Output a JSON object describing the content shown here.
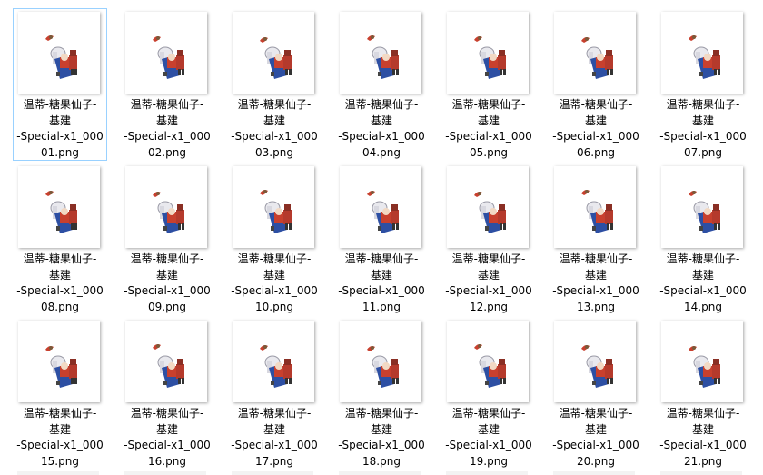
{
  "files": [
    {
      "name_lines": [
        "温蒂-糖果仙子-",
        "基建",
        "-Special-x1_000",
        "01.png"
      ],
      "selected": true
    },
    {
      "name_lines": [
        "温蒂-糖果仙子-",
        "基建",
        "-Special-x1_000",
        "02.png"
      ]
    },
    {
      "name_lines": [
        "温蒂-糖果仙子-",
        "基建",
        "-Special-x1_000",
        "03.png"
      ]
    },
    {
      "name_lines": [
        "温蒂-糖果仙子-",
        "基建",
        "-Special-x1_000",
        "04.png"
      ]
    },
    {
      "name_lines": [
        "温蒂-糖果仙子-",
        "基建",
        "-Special-x1_000",
        "05.png"
      ]
    },
    {
      "name_lines": [
        "温蒂-糖果仙子-",
        "基建",
        "-Special-x1_000",
        "06.png"
      ]
    },
    {
      "name_lines": [
        "温蒂-糖果仙子-",
        "基建",
        "-Special-x1_000",
        "07.png"
      ]
    },
    {
      "name_lines": [
        "温蒂-糖果仙子-",
        "基建",
        "-Special-x1_000",
        "08.png"
      ]
    },
    {
      "name_lines": [
        "温蒂-糖果仙子-",
        "基建",
        "-Special-x1_000",
        "09.png"
      ]
    },
    {
      "name_lines": [
        "温蒂-糖果仙子-",
        "基建",
        "-Special-x1_000",
        "10.png"
      ]
    },
    {
      "name_lines": [
        "温蒂-糖果仙子-",
        "基建",
        "-Special-x1_000",
        "11.png"
      ]
    },
    {
      "name_lines": [
        "温蒂-糖果仙子-",
        "基建",
        "-Special-x1_000",
        "12.png"
      ]
    },
    {
      "name_lines": [
        "温蒂-糖果仙子-",
        "基建",
        "-Special-x1_000",
        "13.png"
      ]
    },
    {
      "name_lines": [
        "温蒂-糖果仙子-",
        "基建",
        "-Special-x1_000",
        "14.png"
      ]
    },
    {
      "name_lines": [
        "温蒂-糖果仙子-",
        "基建",
        "-Special-x1_000",
        "15.png"
      ]
    },
    {
      "name_lines": [
        "温蒂-糖果仙子-",
        "基建",
        "-Special-x1_000",
        "16.png"
      ]
    },
    {
      "name_lines": [
        "温蒂-糖果仙子-",
        "基建",
        "-Special-x1_000",
        "17.png"
      ]
    },
    {
      "name_lines": [
        "温蒂-糖果仙子-",
        "基建",
        "-Special-x1_000",
        "18.png"
      ]
    },
    {
      "name_lines": [
        "温蒂-糖果仙子-",
        "基建",
        "-Special-x1_000",
        "19.png"
      ]
    },
    {
      "name_lines": [
        "温蒂-糖果仙子-",
        "基建",
        "-Special-x1_000",
        "20.png"
      ]
    },
    {
      "name_lines": [
        "温蒂-糖果仙子-",
        "基建",
        "-Special-x1_000",
        "21.png"
      ]
    }
  ],
  "colors": {
    "selection_border": "#99d1ff",
    "sprite_blue": "#2d4fa3",
    "sprite_red": "#c8402e",
    "sprite_white": "#e9e9ee"
  },
  "icon": "sprite-thumbnail-icon"
}
